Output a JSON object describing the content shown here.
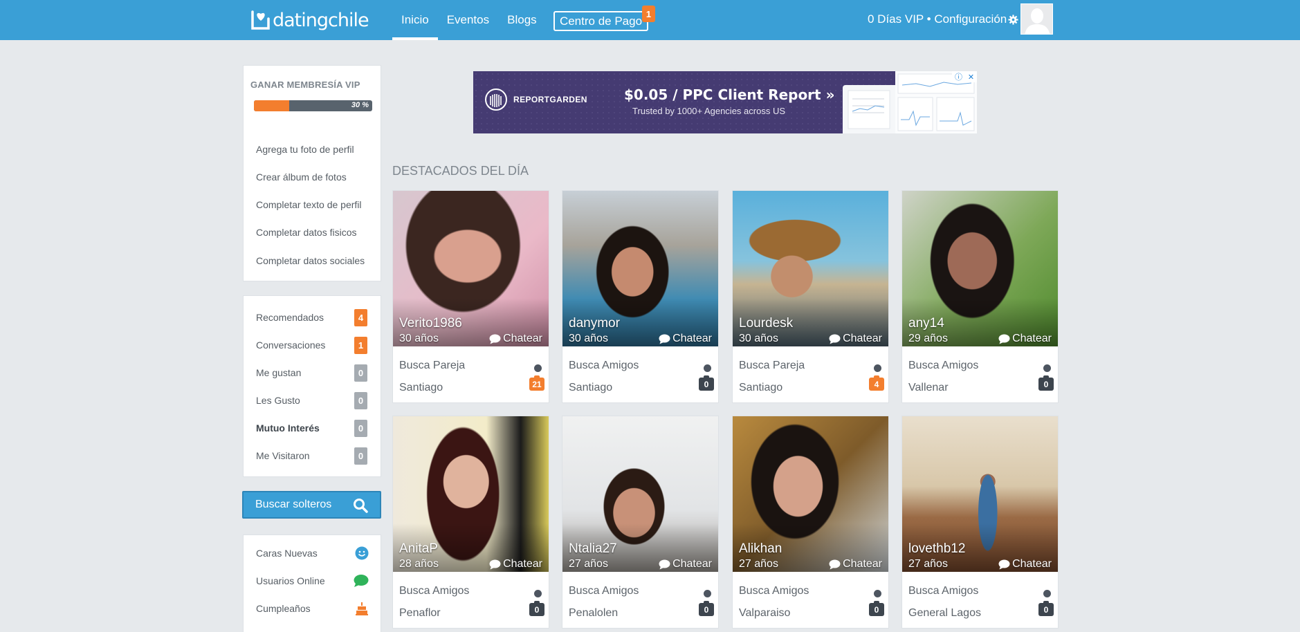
{
  "header": {
    "logo_text": "datingchile",
    "nav": [
      "Inicio",
      "Eventos",
      "Blogs"
    ],
    "pay_label": "Centro de Pago",
    "pay_badge": "1",
    "vip_status": "0 Días VIP • Configuración"
  },
  "sidebar": {
    "vip_title": "GANAR MEMBRESÍA VIP",
    "progress_label": "30 %",
    "progress_value": 0.3,
    "tasks": [
      "Agrega tu foto de perfil",
      "Crear álbum de fotos",
      "Completar texto de perfil",
      "Completar datos fisicos",
      "Completar datos sociales"
    ],
    "counts": [
      {
        "label": "Recomendados",
        "count": "4",
        "color": "orange"
      },
      {
        "label": "Conversaciones",
        "count": "1",
        "color": "orange"
      },
      {
        "label": "Me gustan",
        "count": "0",
        "color": "grey"
      },
      {
        "label": "Les Gusto",
        "count": "0",
        "color": "grey"
      },
      {
        "label": "Mutuo Interés",
        "count": "0",
        "color": "grey"
      },
      {
        "label": "Me Visitaron",
        "count": "0",
        "color": "grey"
      }
    ],
    "search_label": "Buscar solteros",
    "extras": [
      {
        "label": "Caras Nuevas",
        "icon": "smiley-icon"
      },
      {
        "label": "Usuarios Online",
        "icon": "chat-bubble-icon"
      },
      {
        "label": "Cumpleaños",
        "icon": "cake-icon"
      }
    ]
  },
  "ad": {
    "brand": "REPORTGARDEN",
    "headline": "$0.05 / PPC Client Report »",
    "subline": "Trusted by 1000+ Agencies across US"
  },
  "main": {
    "section_title": "DESTACADOS DEL DÍA",
    "chat_label": "Chatear",
    "profiles": [
      {
        "name": "Verito1986",
        "age": "30 años",
        "seeking": "Busca Pareja",
        "city": "Santiago",
        "photos": "21",
        "photos_color": "orange"
      },
      {
        "name": "danymor",
        "age": "30 años",
        "seeking": "Busca Amigos",
        "city": "Santiago",
        "photos": "0",
        "photos_color": "dark"
      },
      {
        "name": "Lourdesk",
        "age": "30 años",
        "seeking": "Busca Pareja",
        "city": "Santiago",
        "photos": "4",
        "photos_color": "orange"
      },
      {
        "name": "any14",
        "age": "29 años",
        "seeking": "Busca Amigos",
        "city": "Vallenar",
        "photos": "0",
        "photos_color": "dark"
      },
      {
        "name": "AnitaP",
        "age": "28 años",
        "seeking": "Busca Amigos",
        "city": "Penaflor",
        "photos": "0",
        "photos_color": "dark"
      },
      {
        "name": "Ntalia27",
        "age": "27 años",
        "seeking": "Busca Amigos",
        "city": "Penalolen",
        "photos": "0",
        "photos_color": "dark"
      },
      {
        "name": "Alikhan",
        "age": "27 años",
        "seeking": "Busca Amigos",
        "city": "Valparaiso",
        "photos": "0",
        "photos_color": "dark"
      },
      {
        "name": "lovethb12",
        "age": "27 años",
        "seeking": "Busca Amigos",
        "city": "General Lagos",
        "photos": "0",
        "photos_color": "dark"
      }
    ]
  }
}
